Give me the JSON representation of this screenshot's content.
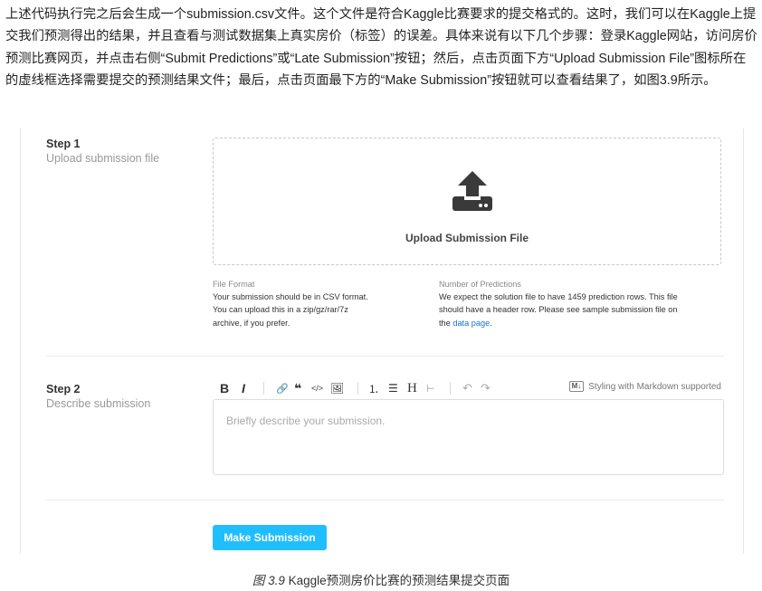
{
  "paragraph": {
    "text": "上述代码执行完之后会生成一个submission.csv文件。这个文件是符合Kaggle比赛要求的提交格式的。这时，我们可以在Kaggle上提交我们预测得出的结果，并且查看与测试数据集上真实房价（标签）的误差。具体来说有以下几个步骤：登录Kaggle网站，访问房价预测比赛网页，并点击右侧“Submit Predictions”或“Late Submission”按钮；然后，点击页面下方“Upload Submission File”图标所在的虚线框选择需要提交的预测结果文件；最后，点击页面最下方的“Make Submission”按钮就可以查看结果了，如图3.9所示。"
  },
  "step1": {
    "title": "Step 1",
    "subtitle": "Upload submission file",
    "upload_label": "Upload Submission File",
    "upload_icon": "upload-icon",
    "file_format": {
      "heading": "File Format",
      "line1": "Your submission should be in CSV format.",
      "line2": "You can upload this in a zip/gz/rar/7z",
      "line3": "archive, if you prefer."
    },
    "num_predictions": {
      "heading": "Number of Predictions",
      "line1": "We expect the solution file to have 1459 prediction rows. This file",
      "line2": "should have a header row. Please see sample submission file on",
      "line3_prefix": "the ",
      "link": "data page",
      "line3_suffix": "."
    }
  },
  "step2": {
    "title": "Step 2",
    "subtitle": "Describe submission",
    "toolbar": {
      "bold": "B",
      "italic": "I",
      "link": "🔗",
      "quote": "❝",
      "code": "</>",
      "image": "🖼",
      "ordered_list": "⒈",
      "bullet_list": "☰",
      "heading": "H",
      "hr": "⊢",
      "undo": "↶",
      "redo": "↷"
    },
    "markdown_badge": "M↓",
    "markdown_note": "Styling with Markdown supported",
    "placeholder": "Briefly describe your submission."
  },
  "submit_label": "Make Submission",
  "caption": {
    "figure": "图 3.9",
    "text": "Kaggle预测房价比赛的预测结果提交页面"
  }
}
